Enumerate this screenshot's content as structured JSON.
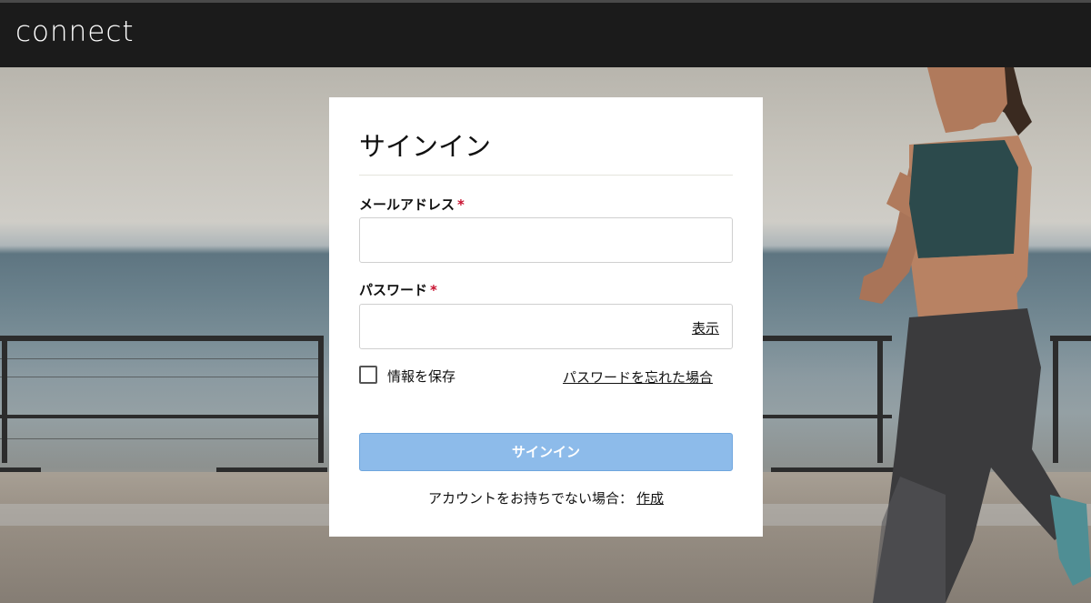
{
  "header": {
    "logo_text": "connect"
  },
  "signin": {
    "title": "サインイン",
    "email_label": "メールアドレス",
    "email_required_mark": "*",
    "email_value": "",
    "password_label": "パスワード",
    "password_required_mark": "*",
    "password_value": "",
    "show_password_label": "表示",
    "remember_label": "情報を保存",
    "remember_checked": false,
    "forgot_password_label": "パスワードを忘れた場合",
    "submit_label": "サインイン",
    "no_account_text": "アカウントをお持ちでない場合：",
    "create_label": "作成"
  },
  "colors": {
    "topbar": "#1b1b1b",
    "button": "#8dbbea",
    "required": "#c8102e"
  }
}
